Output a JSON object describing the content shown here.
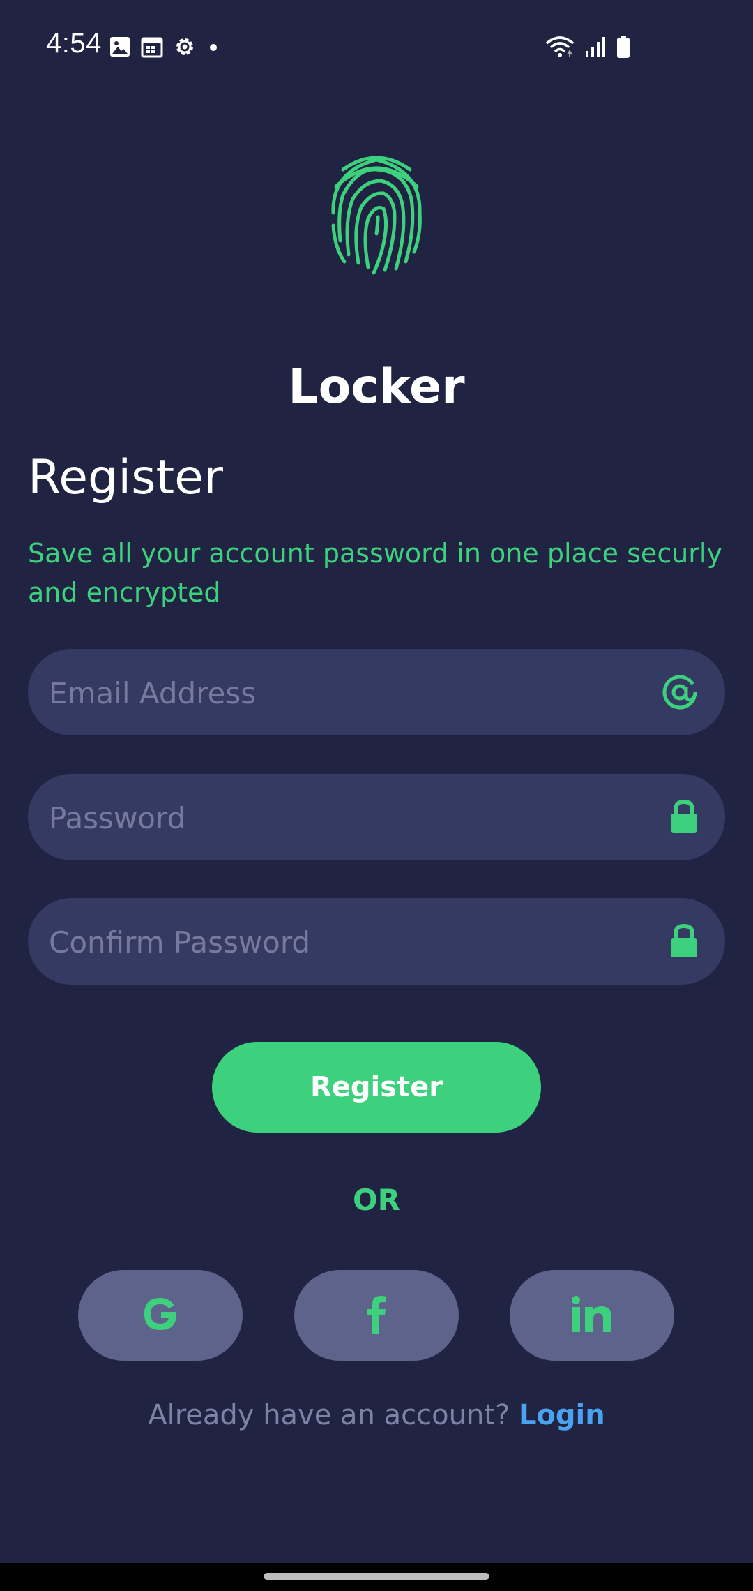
{
  "status_bar": {
    "time": "4:54",
    "left_icons": [
      "image-icon",
      "calendar-icon",
      "settings-icon",
      "dot-icon"
    ],
    "right_icons": [
      "wifi-icon",
      "signal-icon",
      "battery-icon"
    ]
  },
  "app": {
    "title": "Locker",
    "logo_icon": "fingerprint-icon"
  },
  "register": {
    "heading": "Register",
    "subtitle": "Save all your account password in one place securly and encrypted",
    "email_placeholder": "Email Address",
    "password_placeholder": "Password",
    "confirm_placeholder": "Confirm Password",
    "submit_label": "Register",
    "or_label": "OR",
    "social": [
      {
        "icon": "google-icon",
        "glyph": "G"
      },
      {
        "icon": "facebook-icon",
        "glyph": "f"
      },
      {
        "icon": "linkedin-icon",
        "glyph": "in"
      }
    ],
    "footer_text": "Already have an account?",
    "login_label": "Login"
  },
  "colors": {
    "background": "#202341",
    "accent": "#3dd17d",
    "field": "#353a62",
    "social_button": "#5e638c",
    "link": "#4aa3f0"
  }
}
